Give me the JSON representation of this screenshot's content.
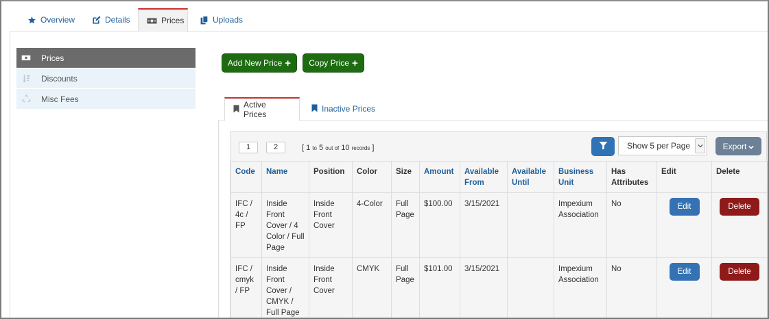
{
  "top_tabs": [
    {
      "label": "Overview",
      "icon": "star-icon"
    },
    {
      "label": "Details",
      "icon": "edit-icon"
    },
    {
      "label": "Prices",
      "icon": "money-icon",
      "active": true
    },
    {
      "label": "Uploads",
      "icon": "copy-icon"
    }
  ],
  "sidebar": {
    "items": [
      {
        "label": "Prices",
        "icon": "money-icon",
        "active": true
      },
      {
        "label": "Discounts",
        "icon": "sort-icon"
      },
      {
        "label": "Misc Fees",
        "icon": "recycle-icon"
      }
    ]
  },
  "actions": {
    "add_new_price": "Add New Price",
    "copy_price": "Copy Price"
  },
  "inner_tabs": [
    {
      "label": "Active Prices",
      "icon": "bookmark-icon",
      "active": true
    },
    {
      "label": "Inactive Prices",
      "icon": "bookmark-icon"
    }
  ],
  "pager": {
    "pages": [
      "1",
      "2"
    ],
    "records_prefix": "[ 1",
    "records_to": "to",
    "records_mid": "5",
    "records_outof": "out of",
    "records_total": "10",
    "records_word": "records",
    "records_suffix": "]"
  },
  "toolbar": {
    "per_page": "Show 5 per Page",
    "export": "Export"
  },
  "table": {
    "headers": [
      "Code",
      "Name",
      "Position",
      "Color",
      "Size",
      "Amount",
      "Available From",
      "Available Until",
      "Business Unit",
      "Has Attributes",
      "Edit",
      "Delete"
    ],
    "edit_label": "Edit",
    "delete_label": "Delete",
    "rows": [
      {
        "code": "IFC / 4c / FP",
        "name": "Inside Front Cover / 4 Color / Full Page",
        "position": "Inside Front Cover",
        "color": "4-Color",
        "size": "Full Page",
        "amount": "$100.00",
        "from": "3/15/2021",
        "until": "",
        "unit": "Impexium Association",
        "attributes": "No"
      },
      {
        "code": "IFC / cmyk / FP",
        "name": "Inside Front Cover / CMYK / Full Page",
        "position": "Inside Front Cover",
        "color": "CMYK",
        "size": "Full Page",
        "amount": "$101.00",
        "from": "3/15/2021",
        "until": "",
        "unit": "Impexium Association",
        "attributes": "No"
      }
    ]
  },
  "colors": {
    "accent_blue": "#1f5f9a",
    "green": "#1e6b12",
    "delete_red": "#8f1a1a",
    "active_tab_border": "#c9302c"
  }
}
